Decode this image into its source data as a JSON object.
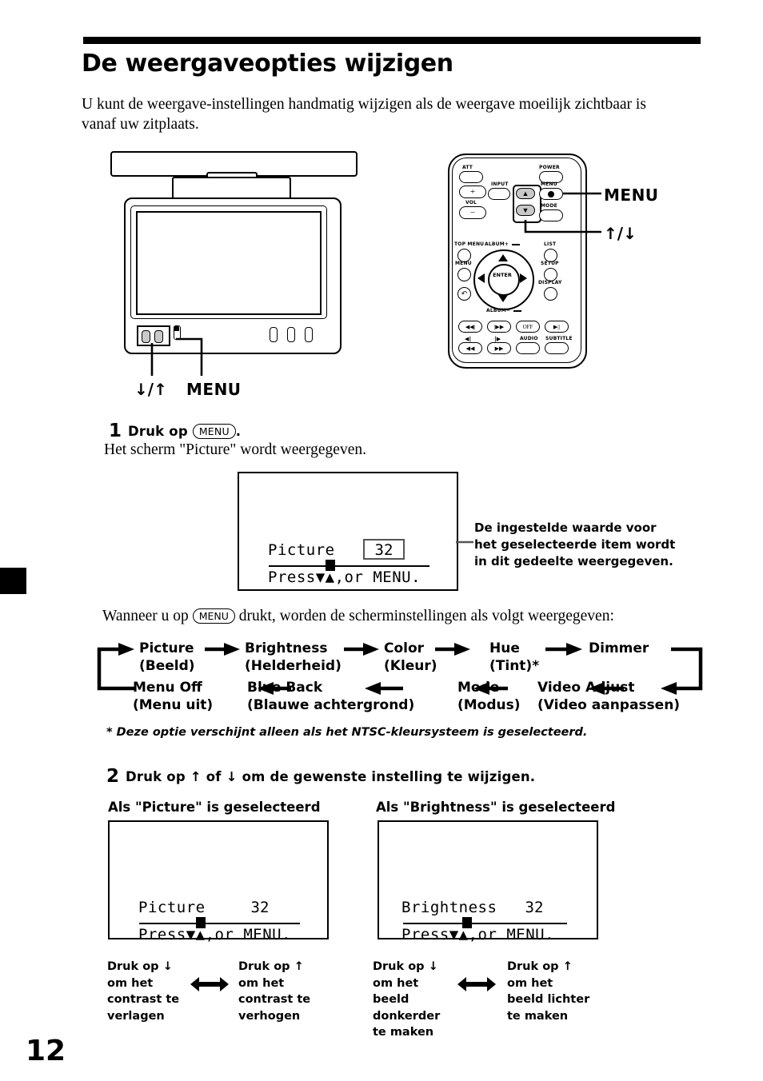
{
  "page": {
    "title": "De weergaveopties wijzigen",
    "intro": "U kunt de weergave-instellingen handmatig wijzigen als de weergave moeilijk zichtbaar is vanaf uw zitplaats.",
    "number": "12"
  },
  "monitor_diagram": {
    "label_updown": "↓/↑",
    "label_menu": "MENU"
  },
  "remote_diagram": {
    "label_menu": "MENU",
    "label_updown": "↑/↓",
    "buttons": [
      {
        "name": "att",
        "label": "ATT"
      },
      {
        "name": "power",
        "label": "POWER"
      },
      {
        "name": "input",
        "label": "INPUT"
      },
      {
        "name": "menu",
        "label": "MENU"
      },
      {
        "name": "vol",
        "label": "VOL"
      },
      {
        "name": "mode",
        "label": "MODE"
      },
      {
        "name": "top-menu",
        "label": "TOP MENU"
      },
      {
        "name": "album-plus",
        "label": "ALBUM+"
      },
      {
        "name": "list",
        "label": "LIST"
      },
      {
        "name": "menu-lower",
        "label": "MENU"
      },
      {
        "name": "setup",
        "label": "SETUP"
      },
      {
        "name": "display",
        "label": "DISPLAY"
      },
      {
        "name": "album-minus",
        "label": "ALBUM−"
      },
      {
        "name": "enter",
        "label": "ENTER"
      },
      {
        "name": "off",
        "label": "OFF"
      },
      {
        "name": "audio",
        "label": "AUDIO"
      },
      {
        "name": "subtitle",
        "label": "SUBTITLE"
      }
    ],
    "vol_plus": "+",
    "vol_minus": "−"
  },
  "step1": {
    "number": "1",
    "prefix": "Druk op",
    "key": "MENU",
    "suffix": ".",
    "sub": "Het scherm \"Picture\" wordt weergegeven."
  },
  "osd1": {
    "label": "Picture",
    "value": "32",
    "press": "Press▼▲,or MENU."
  },
  "callout1": {
    "text": "De ingestelde waarde voor het geselecteerde item wordt in dit gedeelte weergegeven."
  },
  "flow": {
    "intro_before": "Wanneer u op",
    "intro_key": "MENU",
    "intro_after": "drukt, worden de scherminstellingen als volgt weergegeven:",
    "top_row": [
      {
        "en": "Picture",
        "nl": "(Beeld)"
      },
      {
        "en": "Brightness",
        "nl": "(Helderheid)"
      },
      {
        "en": "Color",
        "nl": "(Kleur)"
      },
      {
        "en": "Hue",
        "nl": "(Tint)*"
      },
      {
        "en": "Dimmer",
        "nl": ""
      }
    ],
    "bottom_row": [
      {
        "en": "Menu Off",
        "nl": "(Menu uit)"
      },
      {
        "en": "Blue Back",
        "nl": "(Blauwe achtergrond)"
      },
      {
        "en": "Mode",
        "nl": "(Modus)"
      },
      {
        "en": "Video Adjust",
        "nl": "(Video aanpassen)"
      }
    ],
    "note": "* Deze optie verschijnt alleen als het NTSC-kleursysteem is geselecteerd."
  },
  "step2": {
    "number": "2",
    "text_a": "Druk op",
    "arrow_up": "↑",
    "text_b": "of",
    "arrow_down": "↓",
    "text_c": "om de gewenste instelling te wijzigen.",
    "full": "Druk op ↑ of ↓ om de gewenste instelling te wijzigen."
  },
  "subheads": {
    "a": "Als \"Picture\" is geselecteerd",
    "b": "Als \"Brightness\" is geselecteerd"
  },
  "osd2": {
    "label": "Picture",
    "value": "32",
    "press": "Press▼▲,or MENU."
  },
  "osd3": {
    "label": "Brightness",
    "value": "32",
    "press": "Press▼▲,or MENU."
  },
  "captions": {
    "a": "Druk op ↓ om het contrast te verlagen",
    "b": "Druk op ↑ om het contrast te verhogen",
    "c": "Druk op ↓ om het beeld donkerder te maken",
    "d": "Druk op ↑ om het beeld lichter te maken"
  },
  "colors": {
    "ink": "#000000",
    "button_fill": "#c9c9c9",
    "valuebox_border": "#555555"
  }
}
